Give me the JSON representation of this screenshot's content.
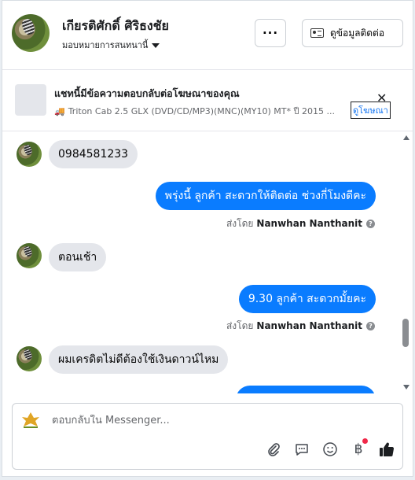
{
  "header": {
    "contact_name": "เกียรติศักดิ์ ศิริธงชัย",
    "assign_label": "มอบหมายการสนทนานี้",
    "more_label": "···",
    "contact_button_label": "ดูข้อมูลติดต่อ"
  },
  "ad_banner": {
    "title": "แชทนี้มีข้อความตอบกลับต่อโฆษณาของคุณ",
    "product": "Triton Cab 2.5 GLX (DVD/CD/MP3)(MNC)(MY10) MT* ปี 2015 ...",
    "view_ad_label": "ดูโฆษณา",
    "close_label": "✕"
  },
  "messages": [
    {
      "direction": "in",
      "text": "0984581233"
    },
    {
      "direction": "out",
      "text": "พรุ่งนี้ ลูกค้า สะดวกให้ติดต่อ ช่วงกี่โมงดีคะ",
      "sent_by_label": "ส่งโดย",
      "sent_by_name": "Nanwhan Nanthanit"
    },
    {
      "direction": "in",
      "text": "ตอนเช้า"
    },
    {
      "direction": "out",
      "text": "9.30 ลูกค้า สะดวกมั้ยคะ",
      "sent_by_label": "ส่งโดย",
      "sent_by_name": "Nanwhan Nanthanit"
    },
    {
      "direction": "in",
      "text": "ผมเครดิตไม่ดีต้องใช้เงินดาวน์ไหม"
    }
  ],
  "composer": {
    "placeholder": "ตอบกลับใน Messenger...",
    "currency_symbol": "฿"
  },
  "icons": {
    "attach": "paperclip-icon",
    "saved_replies": "chat-bubble-icon",
    "emoji": "smiley-icon",
    "payment": "baht-icon",
    "like": "thumbs-up-icon"
  },
  "colors": {
    "outgoing_bubble": "#0a7cff",
    "incoming_bubble": "#e4e6eb",
    "link": "#1877f2",
    "notification": "#f02849"
  }
}
